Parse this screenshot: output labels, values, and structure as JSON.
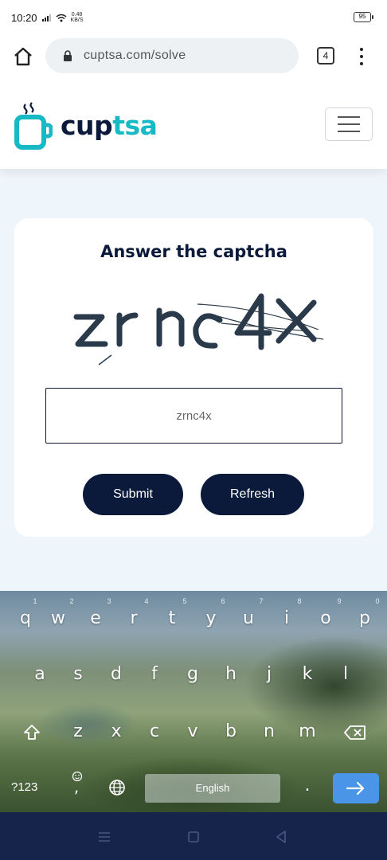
{
  "status_bar": {
    "time": "10:20",
    "net_speed_value": "0.48",
    "net_speed_unit": "KB/S",
    "battery": "95"
  },
  "browser": {
    "url": "cuptsa.com/solve",
    "tab_count": "4"
  },
  "site": {
    "logo_part1": "cup",
    "logo_part2": "tsa",
    "brand_color": "#16b9c4",
    "navy_color": "#0b1a3a"
  },
  "captcha": {
    "title": "Answer the captcha",
    "image_text": "zrnc4X",
    "input_value": "zrnc4x",
    "submit_label": "Submit",
    "refresh_label": "Refresh"
  },
  "keyboard": {
    "row1": [
      "q",
      "w",
      "e",
      "r",
      "t",
      "y",
      "u",
      "i",
      "o",
      "p"
    ],
    "row1_numbers": [
      "1",
      "2",
      "3",
      "4",
      "5",
      "6",
      "7",
      "8",
      "9",
      "0"
    ],
    "row2": [
      "a",
      "s",
      "d",
      "f",
      "g",
      "h",
      "j",
      "k",
      "l"
    ],
    "row3": [
      "z",
      "x",
      "c",
      "v",
      "b",
      "n",
      "m"
    ],
    "symbols_label": "?123",
    "comma": ",",
    "period": ".",
    "space_label": "English",
    "shift_icon": "shift-icon",
    "backspace_icon": "backspace-icon",
    "enter_icon": "arrow-right-icon",
    "language_icon": "globe-icon",
    "emoji_icon": "emoji-icon"
  }
}
